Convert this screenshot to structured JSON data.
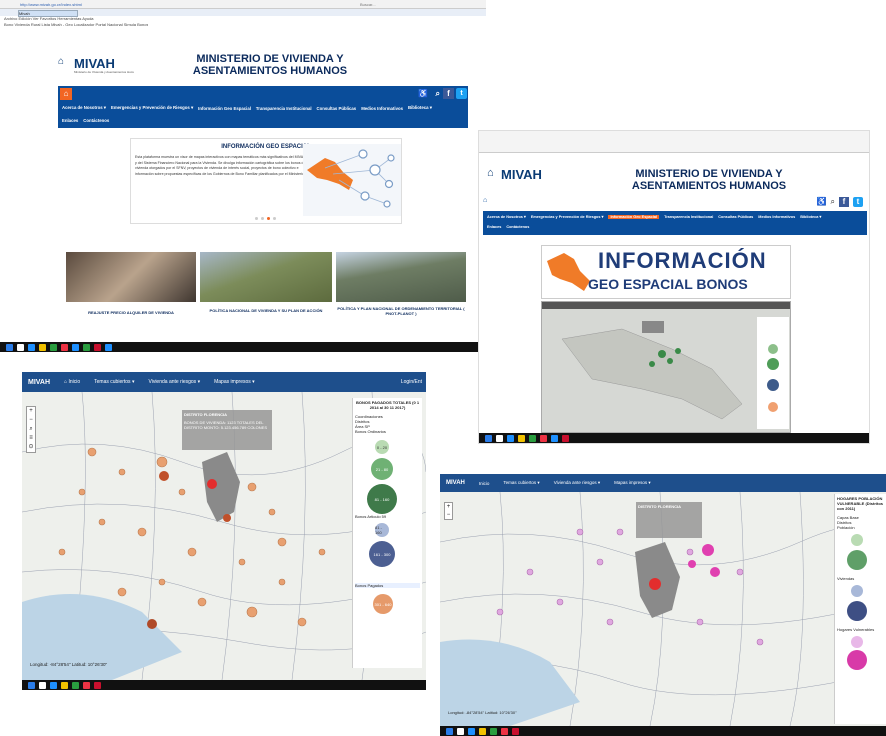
{
  "shot1": {
    "url": "http://www.mivah.go.cr/Index.shtml",
    "browser_tab": "Mivah",
    "search_placeholder": "Buscar...",
    "menu": "Archivo  Edición  Ver  Favoritos  Herramientas  Ayuda",
    "favorites": "Bono Vivienda Rural Lista  Mivah - Geo Localizador  Portal Nacional  Simula Bonos",
    "logo": "MIVAH",
    "logo_sub": "Ministerio de Vivienda y Asentamientos Humanos",
    "ministry_line1": "MINISTERIO DE VIVIENDA Y",
    "ministry_line2": "ASENTAMIENTOS HUMANOS",
    "nav": [
      "Acerca de Nosotros ▾",
      "Emergencias y Prevención de Riesgos ▾",
      "Información Geo Espacial",
      "Transparencia Institucional",
      "Consultas Públicas",
      "Medios Informativos",
      "Biblioteca ▾"
    ],
    "nav2": [
      "Enlaces",
      "Contáctenos"
    ],
    "feature_title": "INFORMACIÓN GEO ESPACIAL",
    "feature_text": "Esta plataforma muestra un visor de mapas interactivos con mapas temáticos más significativos del MIVAH y del Sistema Financiero Nacional para la Vivienda. Se divulga información cartográfica sobre los bonos de vivienda otorgados por el SFNV, proyectos de vivienda de interés social, proyectos de bono colectivo e información sobre propuestas específicas de los Gobiernos de Bono Familiar planificados por el Ministerio.",
    "cards": [
      "REAJUSTE PRECIO ALQUILER DE VIVIENDA",
      "POLÍTICA NACIONAL DE VIVIENDA Y SU PLAN DE ACCIÓN",
      "POLÍTICA Y PLAN NACIONAL DE ORDENAMIENTO TERRITORIAL ( PNOT-PLANOT )"
    ]
  },
  "shot2": {
    "logo": "MIVAH",
    "ministry_line1": "MINISTERIO DE VIVIENDA Y",
    "ministry_line2": "ASENTAMIENTOS HUMANOS",
    "nav": [
      "Acerca de Nosotros ▾",
      "Emergencias y Prevención de Riesgos ▾",
      "Información Geo Espacial",
      "Transparencia Institucional",
      "Consultas Públicas",
      "Medios Informativos",
      "Biblioteca ▾"
    ],
    "nav2": [
      "Enlaces",
      "Contáctenos"
    ],
    "banner_line1": "INFORMACIÓN",
    "banner_line2": "GEO ESPACIAL BONOS"
  },
  "shot3": {
    "logo": "MIVAH",
    "toolbar": [
      "Inicio",
      "Temas cubiertos ▾",
      "Vivienda ante riesgos ▾",
      "Mapas impresos ▾"
    ],
    "login": "Login/Ent",
    "popup_title": "DISTRITO FLORENCIA",
    "popup_body": "BONOS DE VIVIENDA: 1123 TOTALES DEL DISTRITO MONTO: 5.123.456.789 COLONES",
    "legend_title": "BONOS PAGADOS TOTALES (0 1 2014 al 30 11 2017)",
    "legend_items": [
      "Coordinaciones",
      "Distritos",
      "Área SP",
      "Bonos Ordinarios",
      "Bonos Articulo 59",
      "Bonos Pagados"
    ],
    "bubble_labels": [
      "0 - 20",
      "21 - 80",
      "81 - 160",
      "161 - 300",
      "301 - 640"
    ],
    "coords": "Longitud: -84°28'54\" Latitud: 10°26'30\""
  },
  "shot4": {
    "logo": "MIVAH",
    "toolbar": [
      "Inicio",
      "Temas cubiertos ▾",
      "Vivienda ante riesgos ▾",
      "Mapas impresos ▾"
    ],
    "popup_title": "DISTRITO FLORENCIA",
    "legend_title": "HOGARES POBLACIÓN VULNERABLE (Distritos con 2011)",
    "legend_items": [
      "Capas Base",
      "Distritos",
      "Población",
      "Viviendas",
      "Hogares Vulnerables"
    ],
    "coords": "Longitud: -84°28'54\" Latitud: 10°26'30\""
  }
}
